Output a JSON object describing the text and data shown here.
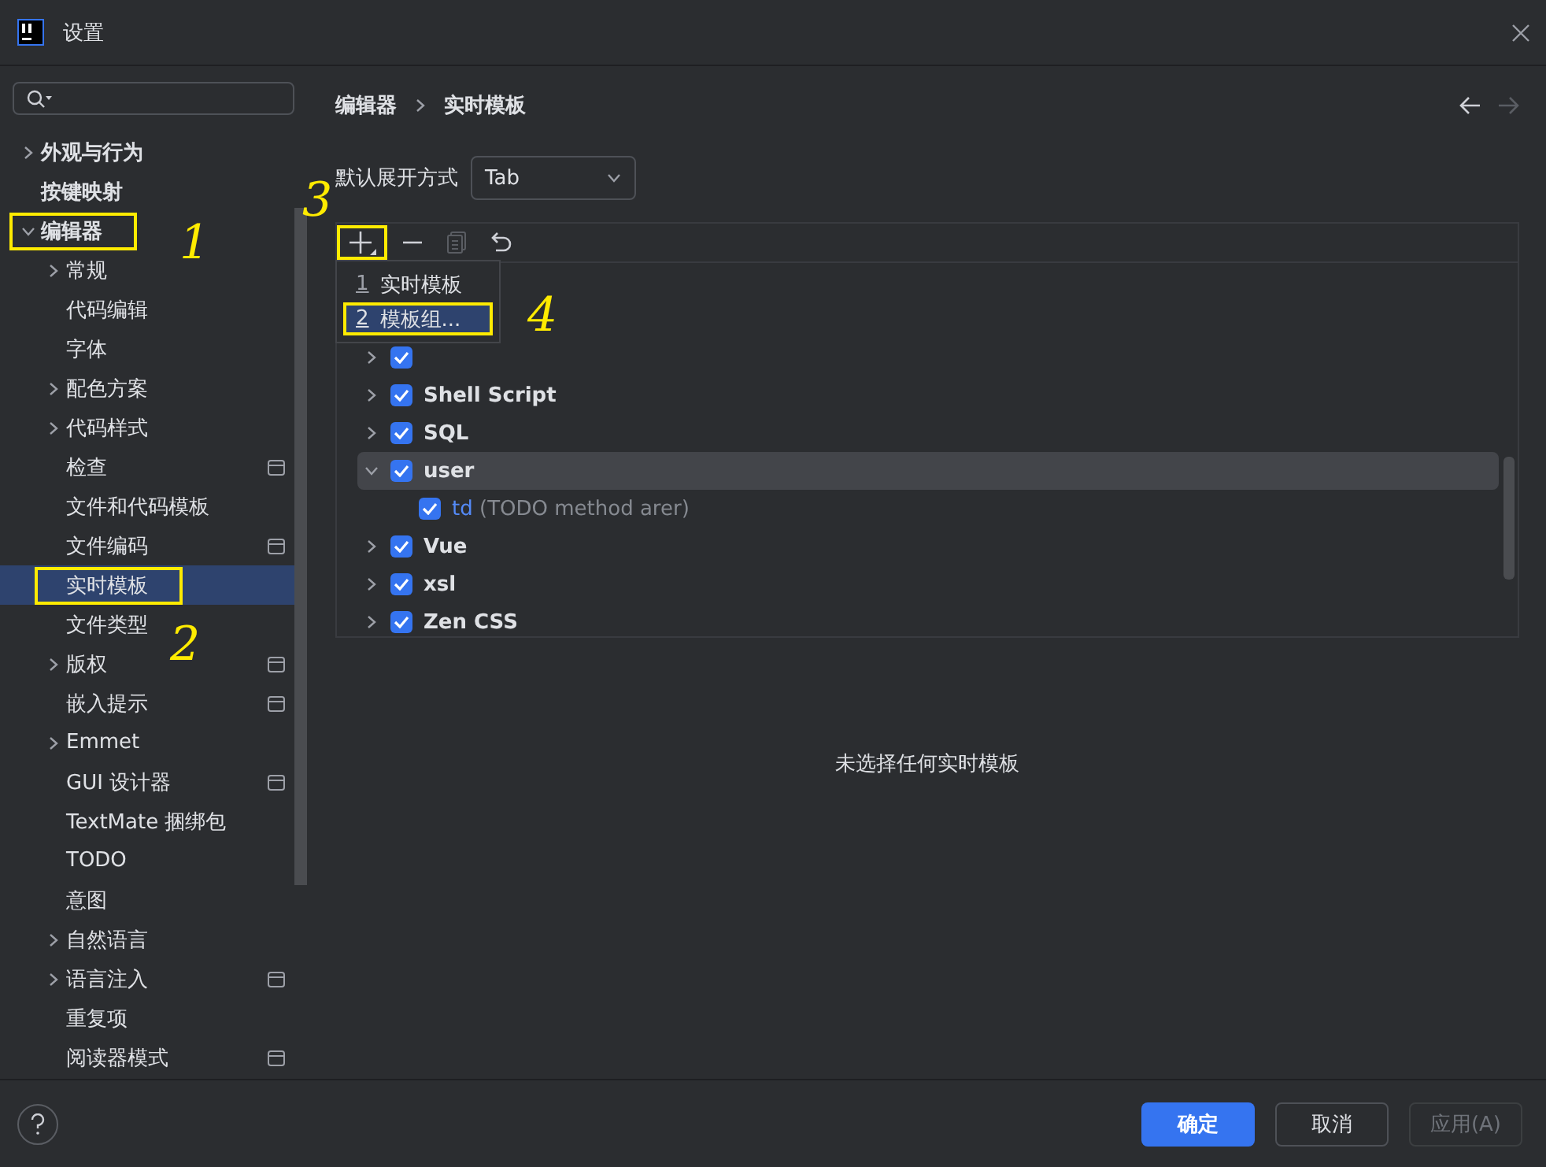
{
  "window": {
    "title": "设置"
  },
  "sidebar": {
    "items": [
      {
        "label": "外观与行为",
        "kind": "branch",
        "expanded": false,
        "selected": false,
        "badge": false,
        "marked": false
      },
      {
        "label": "按键映射",
        "kind": "leaf",
        "selected": false,
        "badge": false,
        "marked": false
      },
      {
        "label": "编辑器",
        "kind": "branch",
        "expanded": true,
        "selected": false,
        "badge": false,
        "marked": true,
        "children": [
          {
            "label": "常规",
            "kind": "branch",
            "expanded": false,
            "selected": false,
            "badge": false,
            "marked": false
          },
          {
            "label": "代码编辑",
            "kind": "leaf",
            "selected": false,
            "badge": false,
            "marked": false
          },
          {
            "label": "字体",
            "kind": "leaf",
            "selected": false,
            "badge": false,
            "marked": false
          },
          {
            "label": "配色方案",
            "kind": "branch",
            "expanded": false,
            "selected": false,
            "badge": false,
            "marked": false
          },
          {
            "label": "代码样式",
            "kind": "branch",
            "expanded": false,
            "selected": false,
            "badge": false,
            "marked": false
          },
          {
            "label": "检查",
            "kind": "leaf",
            "selected": false,
            "badge": true,
            "marked": false
          },
          {
            "label": "文件和代码模板",
            "kind": "leaf",
            "selected": false,
            "badge": false,
            "marked": false
          },
          {
            "label": "文件编码",
            "kind": "leaf",
            "selected": false,
            "badge": true,
            "marked": false
          },
          {
            "label": "实时模板",
            "kind": "leaf",
            "selected": true,
            "badge": false,
            "marked": true
          },
          {
            "label": "文件类型",
            "kind": "leaf",
            "selected": false,
            "badge": false,
            "marked": false
          },
          {
            "label": "版权",
            "kind": "branch",
            "expanded": false,
            "selected": false,
            "badge": true,
            "marked": false
          },
          {
            "label": "嵌入提示",
            "kind": "leaf",
            "selected": false,
            "badge": true,
            "marked": false
          },
          {
            "label": "Emmet",
            "kind": "branch",
            "expanded": false,
            "selected": false,
            "badge": false,
            "marked": false
          },
          {
            "label": "GUI 设计器",
            "kind": "leaf",
            "selected": false,
            "badge": true,
            "marked": false
          },
          {
            "label": "TextMate 捆绑包",
            "kind": "leaf",
            "selected": false,
            "badge": false,
            "marked": false
          },
          {
            "label": "TODO",
            "kind": "leaf",
            "selected": false,
            "badge": false,
            "marked": false
          },
          {
            "label": "意图",
            "kind": "leaf",
            "selected": false,
            "badge": false,
            "marked": false
          },
          {
            "label": "自然语言",
            "kind": "branch",
            "expanded": false,
            "selected": false,
            "badge": false,
            "marked": false
          },
          {
            "label": "语言注入",
            "kind": "branch",
            "expanded": false,
            "selected": false,
            "badge": true,
            "marked": false
          },
          {
            "label": "重复项",
            "kind": "leaf",
            "selected": false,
            "badge": false,
            "marked": false
          },
          {
            "label": "阅读器模式",
            "kind": "leaf",
            "selected": false,
            "badge": true,
            "marked": false
          }
        ]
      }
    ]
  },
  "breadcrumb": [
    "编辑器",
    "实时模板"
  ],
  "nav": {
    "back_disabled": false,
    "forward_disabled": true
  },
  "expand_with": {
    "label": "默认展开方式",
    "value": "Tab"
  },
  "toolbar": [
    {
      "kind": "add",
      "disabled": false,
      "marked": true
    },
    {
      "kind": "remove",
      "disabled": false,
      "marked": false
    },
    {
      "kind": "copy",
      "disabled": true,
      "marked": false
    },
    {
      "kind": "undo",
      "disabled": false,
      "marked": false
    }
  ],
  "add_menu": [
    {
      "mnemonic": "1",
      "label": "实时模板",
      "selected": false,
      "marked": false
    },
    {
      "mnemonic": "2",
      "label": "模板组...",
      "selected": true,
      "marked": true
    }
  ],
  "templates": [
    {
      "kind": "group",
      "checked": true,
      "expanded": false,
      "selected": false
    },
    {
      "kind": "group",
      "label": "Shell Script",
      "checked": true,
      "expanded": false,
      "selected": false
    },
    {
      "kind": "group",
      "label": "SQL",
      "checked": true,
      "expanded": false,
      "selected": false
    },
    {
      "kind": "group",
      "label": "user",
      "checked": true,
      "expanded": true,
      "selected": true,
      "children": [
        {
          "kind": "template",
          "abbr": "td",
          "description": "(TODO method arer)",
          "checked": true,
          "selected": false
        }
      ]
    },
    {
      "kind": "group",
      "label": "Vue",
      "checked": true,
      "expanded": false,
      "selected": false
    },
    {
      "kind": "group",
      "label": "xsl",
      "checked": true,
      "expanded": false,
      "selected": false
    },
    {
      "kind": "group",
      "label": "Zen CSS",
      "checked": true,
      "expanded": false,
      "selected": false
    }
  ],
  "empty_text": "未选择任何实时模板",
  "buttons": [
    {
      "label": "确定",
      "kind": "primary",
      "disabled": false
    },
    {
      "label": "取消",
      "kind": "normal",
      "disabled": false
    },
    {
      "label": "应用(A)",
      "kind": "normal",
      "disabled": true
    }
  ],
  "annotations": [
    {
      "label": "1"
    },
    {
      "label": "2"
    },
    {
      "label": "3"
    },
    {
      "label": "4"
    }
  ]
}
